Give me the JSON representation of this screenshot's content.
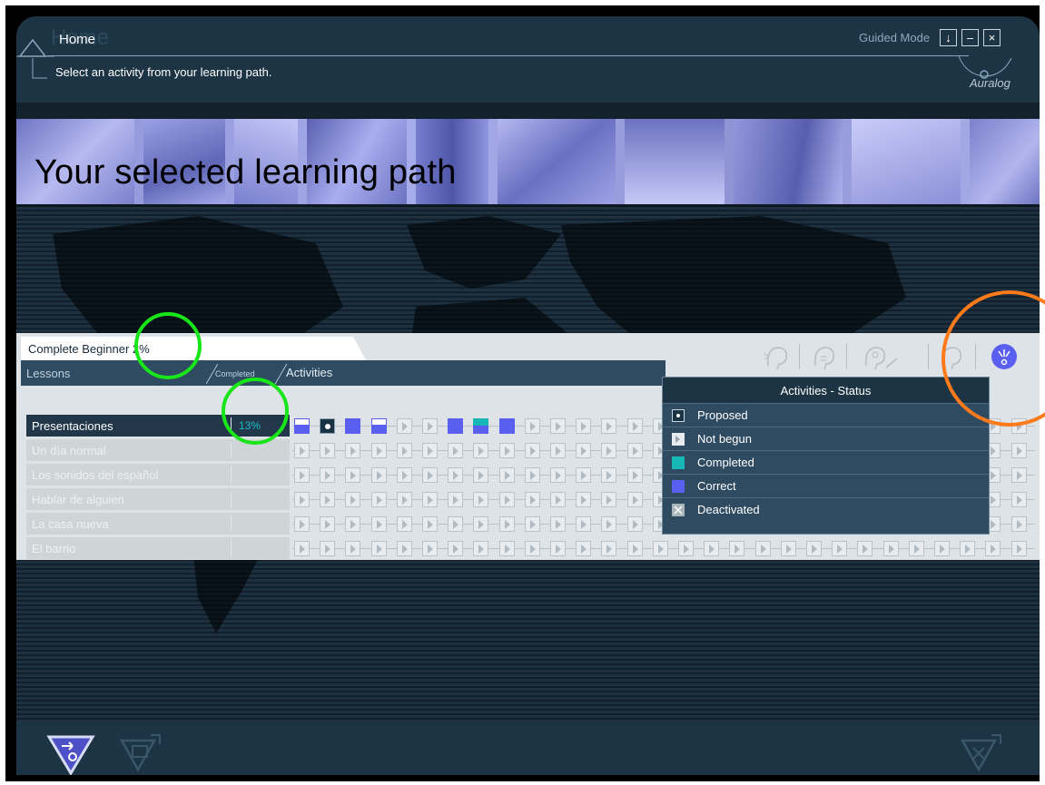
{
  "window": {
    "title": "Home",
    "subtitle": "Select an activity from your learning path.",
    "mode_label": "Guided Mode",
    "brand": "Auralog",
    "buttons": {
      "download": "↓",
      "minimize": "–",
      "close": "×"
    }
  },
  "banner": {
    "title": "Your selected learning path"
  },
  "path": {
    "course": "Complete Beginner 2%",
    "tabs": {
      "lessons": "Lessons",
      "completed": "Completed",
      "activities": "Activities"
    },
    "lessons": [
      {
        "name": "Presentaciones",
        "completed": "13%",
        "active": true,
        "activities": [
          "halfbar",
          "proposed",
          "correct",
          "halfbar",
          "notbegun",
          "notbegun",
          "correct",
          "halfteal",
          "correct",
          "notbegun",
          "notbegun",
          "notbegun",
          "notbegun",
          "notbegun",
          "notbegun",
          "notbegun",
          "notbegun",
          "notbegun",
          "notbegun",
          "notbegun",
          "notbegun",
          "notbegun",
          "notbegun",
          "notbegun",
          "notbegun",
          "notbegun",
          "notbegun",
          "notbegun",
          "notbegun"
        ]
      },
      {
        "name": "Un día normal",
        "completed": "",
        "active": false
      },
      {
        "name": "Los sonidos del español",
        "completed": "",
        "active": false
      },
      {
        "name": "Hablar de alguien",
        "completed": "",
        "active": false
      },
      {
        "name": "La casa nueva",
        "completed": "",
        "active": false
      },
      {
        "name": "El barrio",
        "completed": "",
        "active": false
      }
    ],
    "skill_icons": [
      "listening-icon",
      "speaking-icon",
      "pronunciation-icon",
      "grammar-icon",
      "help-icon"
    ]
  },
  "legend": {
    "title": "Activities - Status",
    "items": [
      {
        "label": "Proposed",
        "status": "proposed"
      },
      {
        "label": "Not begun",
        "status": "notbegun"
      },
      {
        "label": "Completed",
        "status": "completed",
        "color": "#17b7b5"
      },
      {
        "label": "Correct",
        "status": "correct",
        "color": "#5a5ff0"
      },
      {
        "label": "Deactivated",
        "status": "deactivated"
      }
    ]
  },
  "colors": {
    "header": "#1d3444",
    "panel": "#dde3e6",
    "correct": "#5a5ff0",
    "completed": "#17b7b5",
    "annotation_green": "#19e619",
    "annotation_orange": "#ff7a1a"
  }
}
